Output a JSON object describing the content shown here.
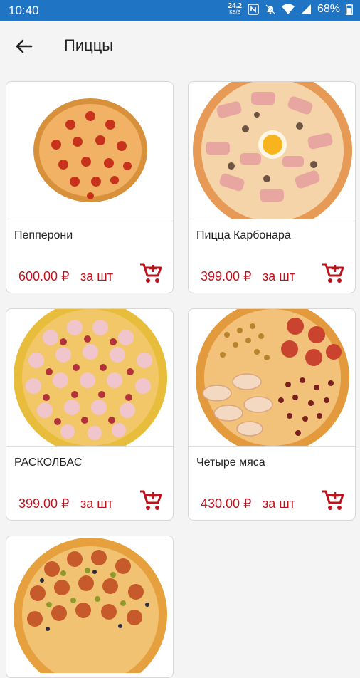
{
  "status": {
    "time": "10:40",
    "speed": "24.2",
    "speed_unit": "KB/S",
    "battery": "68%"
  },
  "header": {
    "title": "Пиццы"
  },
  "products": [
    {
      "name": "Пепперони",
      "price": "600.00 ₽",
      "unit": "за шт"
    },
    {
      "name": "Пицца Карбонара",
      "price": "399.00 ₽",
      "unit": "за шт"
    },
    {
      "name": "РАСКОЛБАС",
      "price": "399.00 ₽",
      "unit": "за шт"
    },
    {
      "name": "Четыре мяса",
      "price": "430.00 ₽",
      "unit": "за шт"
    }
  ],
  "colors": {
    "accent": "#c0121c",
    "statusbar": "#1f74c4"
  },
  "icons": {
    "back": "arrow-left-icon",
    "cart": "cart-add-icon"
  }
}
